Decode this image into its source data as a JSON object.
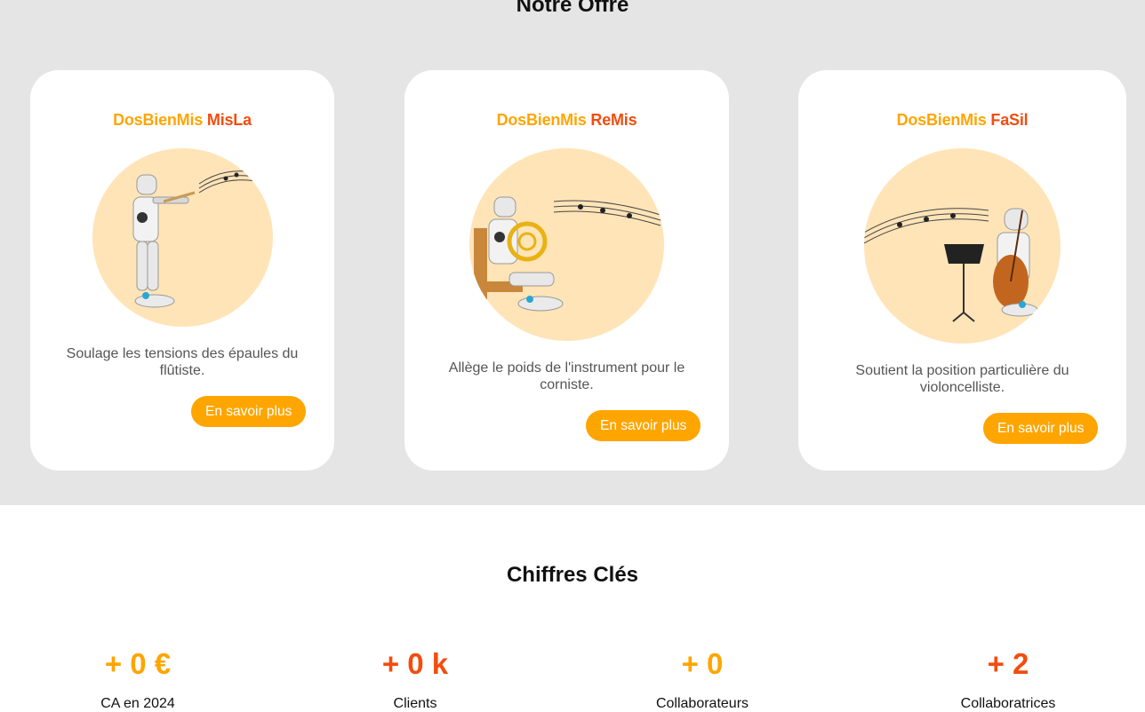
{
  "offer": {
    "title": "Notre Offre",
    "cards": [
      {
        "brand": "DosBienMis",
        "model": "MisLa",
        "description": "Soulage les tensions des épaules du flûtiste.",
        "cta": "En savoir plus",
        "image": "flute-robot-icon"
      },
      {
        "brand": "DosBienMis",
        "model": "ReMis",
        "description": "Allège le poids de l'instrument pour le corniste.",
        "cta": "En savoir plus",
        "image": "horn-robot-icon"
      },
      {
        "brand": "DosBienMis",
        "model": "FaSil",
        "description": "Soutient la position particulière du violoncelliste.",
        "cta": "En savoir plus",
        "image": "cello-robot-icon"
      }
    ]
  },
  "stats": {
    "title": "Chiffres Clés",
    "items": [
      {
        "value": "+ 0 €",
        "label": "CA en 2024",
        "color": "#ffa500"
      },
      {
        "value": "+ 0 k",
        "label": "Clients",
        "color": "#f24d0f"
      },
      {
        "value": "+ 0",
        "label": "Collaborateurs",
        "color": "#ffa500"
      },
      {
        "value": "+ 2",
        "label": "Collaboratrices",
        "color": "#f24d0f"
      }
    ]
  },
  "colors": {
    "brand_orange": "#ffa500",
    "brand_red": "#f24d0f",
    "section_bg": "#e5e5e5",
    "illustration_bg": "#ffe4b8"
  }
}
